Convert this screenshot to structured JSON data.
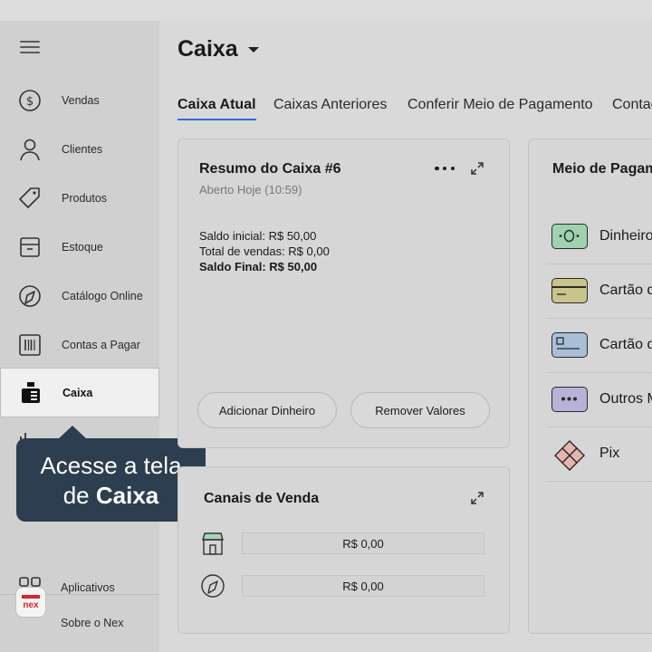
{
  "sidebar": {
    "items": [
      {
        "label": "Vendas",
        "icon": "dollar-circle-icon"
      },
      {
        "label": "Clientes",
        "icon": "user-icon"
      },
      {
        "label": "Produtos",
        "icon": "tag-icon"
      },
      {
        "label": "Estoque",
        "icon": "box-icon"
      },
      {
        "label": "Catálogo Online",
        "icon": "compass-icon"
      },
      {
        "label": "Contas a Pagar",
        "icon": "barcode-icon"
      },
      {
        "label": "Caixa",
        "icon": "cash-register-icon"
      }
    ],
    "apps_label": "Aplicativos",
    "about_label": "Sobre o Nex",
    "logo_text": "nex"
  },
  "tooltip": {
    "line1": "Acesse a tela",
    "line2_prefix": "de",
    "line2_bold": "Caixa"
  },
  "header": {
    "title": "Caixa"
  },
  "tabs": [
    "Caixa Atual",
    "Caixas Anteriores",
    "Conferir Meio de Pagamento",
    "Contad"
  ],
  "resumo": {
    "title": "Resumo do Caixa #6",
    "subtitle": "Aberto Hoje (10:59)",
    "saldo_inicial": "Saldo inicial: R$ 50,00",
    "total_vendas": "Total de vendas: R$ 0,00",
    "saldo_final": "Saldo Final: R$ 50,00",
    "btn_add": "Adicionar Dinheiro",
    "btn_remove": "Remover Valores"
  },
  "canais": {
    "title": "Canais de Venda",
    "rows": [
      {
        "icon": "store-icon",
        "value": "R$ 0,00"
      },
      {
        "icon": "compass-icon",
        "value": "R$ 0,00"
      }
    ]
  },
  "meio": {
    "title": "Meio de Pagam",
    "items": [
      {
        "label": "Dinheiro",
        "color": "#9fd2b0"
      },
      {
        "label": "Cartão d",
        "color": "#c9c48a"
      },
      {
        "label": "Cartão d",
        "color": "#a9bfd8"
      },
      {
        "label": "Outros M",
        "color": "#b7b2d8"
      },
      {
        "label": "Pix",
        "color": "#e6b6ad"
      }
    ]
  }
}
